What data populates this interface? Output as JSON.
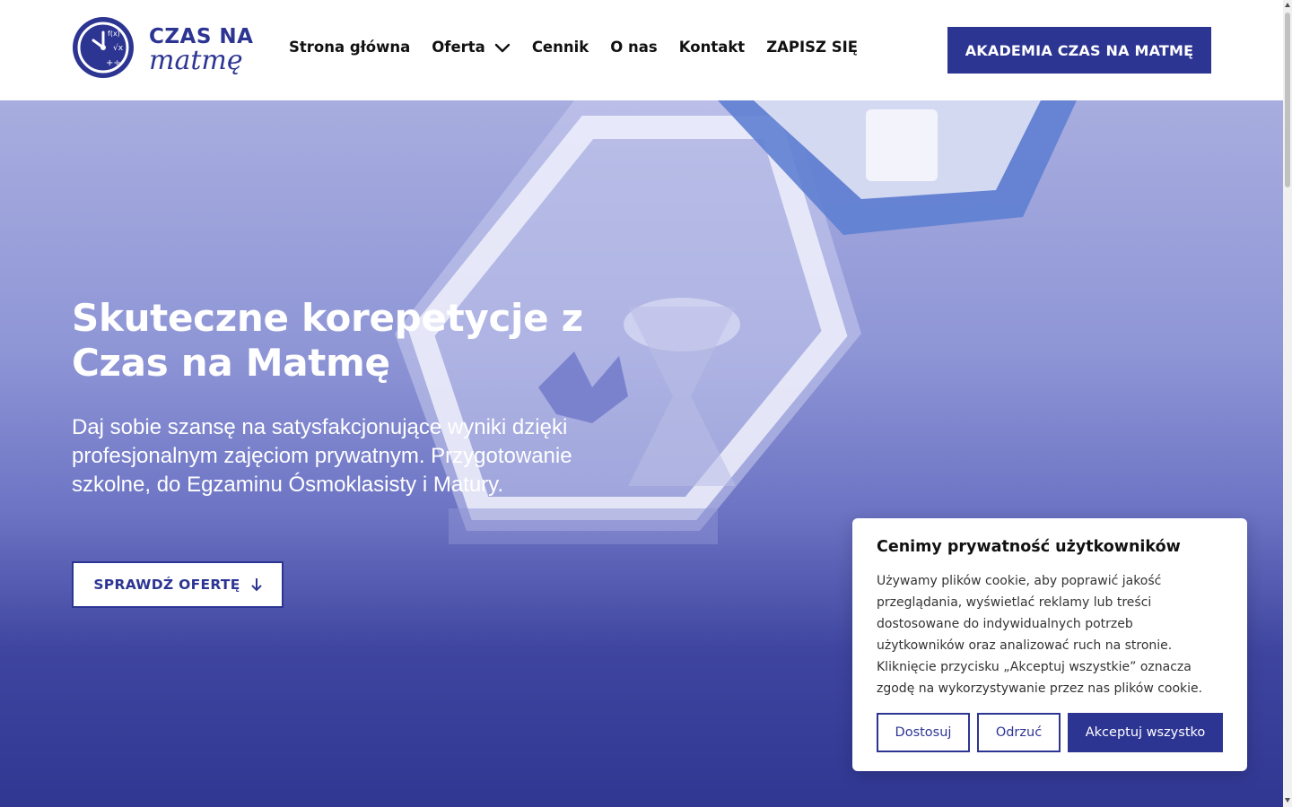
{
  "logo": {
    "line1": "CZAS NA",
    "line2": "matmę"
  },
  "nav": {
    "items": [
      {
        "label": "Strona główna"
      },
      {
        "label": "Oferta"
      },
      {
        "label": "Cennik"
      },
      {
        "label": "O nas"
      },
      {
        "label": "Kontakt"
      },
      {
        "label": "ZAPISZ SIĘ"
      }
    ],
    "cta_label": "AKADEMIA CZAS NA MATMĘ"
  },
  "hero": {
    "title_line1": "Skuteczne korepetycje z",
    "title_line2": "Czas na Matmę",
    "subtitle": "Daj sobie szansę na satysfakcjonujące wyniki dzięki profesjonalnym zajęciom prywatnym. Przygotowanie szkolne, do Egzaminu Ósmoklasisty i Matury.",
    "button_label": "SPRAWDŹ OFERTĘ"
  },
  "cookie": {
    "title": "Cenimy prywatność użytkowników",
    "body": "Używamy plików cookie, aby poprawić jakość przeglądania, wyświetlać reklamy lub treści dostosowane do indywidualnych potrzeb użytkowników oraz analizować ruch na stronie. Kliknięcie przycisku „Akceptuj wszystkie” oznacza zgodę na wykorzystywanie przez nas plików cookie.",
    "btn_customize": "Dostosuj",
    "btn_reject": "Odrzuć",
    "btn_accept": "Akceptuj wszystko"
  },
  "colors": {
    "brand": "#2d3593",
    "white": "#ffffff"
  },
  "icons": {
    "logo": "clock-math-icon",
    "dropdown": "chevron-down-icon",
    "offer_arrow": "arrow-down-icon"
  }
}
